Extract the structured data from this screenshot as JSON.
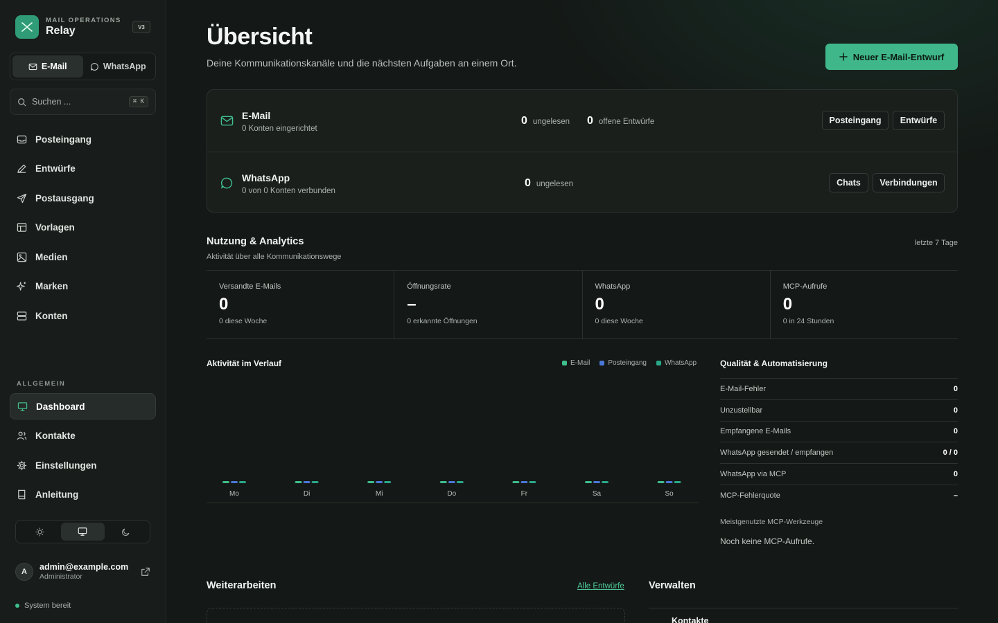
{
  "colors": {
    "accent": "#3fb78a",
    "email_series": "#3fbf8c",
    "inbox_series": "#4a78d6",
    "whatsapp_series": "#2aa98a"
  },
  "brand": {
    "kicker": "MAIL OPERATIONS",
    "name": "Relay",
    "version": "V3",
    "icon": "mail-operations-logo-icon"
  },
  "channel_switch": {
    "email": "E-Mail",
    "whatsapp": "WhatsApp"
  },
  "search": {
    "placeholder": "Suchen ...",
    "shortcut": "⌘ K"
  },
  "nav": {
    "primary": [
      {
        "label": "Posteingang",
        "icon": "inbox-icon"
      },
      {
        "label": "Entwürfe",
        "icon": "pencil-icon"
      },
      {
        "label": "Postausgang",
        "icon": "send-icon"
      },
      {
        "label": "Vorlagen",
        "icon": "template-icon"
      },
      {
        "label": "Medien",
        "icon": "image-icon"
      },
      {
        "label": "Marken",
        "icon": "sparkles-icon"
      },
      {
        "label": "Konten",
        "icon": "server-icon"
      }
    ],
    "section_label": "ALLGEMEIN",
    "general": [
      {
        "label": "Dashboard",
        "icon": "monitor-icon"
      },
      {
        "label": "Kontakte",
        "icon": "users-icon"
      },
      {
        "label": "Einstellungen",
        "icon": "gear-icon"
      },
      {
        "label": "Anleitung",
        "icon": "book-icon"
      }
    ]
  },
  "theme": {
    "options": [
      "light",
      "system",
      "dark"
    ],
    "selected": "system"
  },
  "user": {
    "initial": "A",
    "email": "admin@example.com",
    "role": "Administrator"
  },
  "status": "System bereit",
  "page": {
    "title": "Übersicht",
    "subtitle": "Deine Kommunikationskanäle und die nächsten Aufgaben an einem Ort.",
    "primary_action": "Neuer E-Mail-Entwurf"
  },
  "channels": {
    "email": {
      "name": "E-Mail",
      "sub": "0 Konten eingerichtet",
      "unread_value": "0",
      "unread_label": "ungelesen",
      "drafts_value": "0",
      "drafts_label": "offene Entwürfe",
      "btn1": "Posteingang",
      "btn2": "Entwürfe"
    },
    "whatsapp": {
      "name": "WhatsApp",
      "sub": "0 von 0 Konten verbunden",
      "unread_value": "0",
      "unread_label": "ungelesen",
      "btn1": "Chats",
      "btn2": "Verbindungen"
    }
  },
  "analytics": {
    "title": "Nutzung & Analytics",
    "subtitle": "Aktivität über alle Kommunikationswege",
    "range": "letzte 7 Tage",
    "kpis": [
      {
        "label": "Versandte E-Mails",
        "value": "0",
        "sub": "0 diese Woche"
      },
      {
        "label": "Öffnungsrate",
        "value": "–",
        "sub": "0 erkannte Öffnungen"
      },
      {
        "label": "WhatsApp",
        "value": "0",
        "sub": "0 diese Woche"
      },
      {
        "label": "MCP-Aufrufe",
        "value": "0",
        "sub": "0 in 24 Stunden"
      }
    ]
  },
  "chart_title": "Aktivität im Verlauf",
  "chart_data": {
    "type": "bar",
    "categories": [
      "Mo",
      "Di",
      "Mi",
      "Do",
      "Fr",
      "Sa",
      "So"
    ],
    "series": [
      {
        "name": "E-Mail",
        "values": [
          0,
          0,
          0,
          0,
          0,
          0,
          0
        ]
      },
      {
        "name": "Posteingang",
        "values": [
          0,
          0,
          0,
          0,
          0,
          0,
          0
        ]
      },
      {
        "name": "WhatsApp",
        "values": [
          0,
          0,
          0,
          0,
          0,
          0,
          0
        ]
      }
    ],
    "title": "Aktivität im Verlauf",
    "legend": "top-right",
    "grid": false
  },
  "quality": {
    "title": "Qualität & Automatisierung",
    "rows": [
      {
        "label": "E-Mail-Fehler",
        "value": "0"
      },
      {
        "label": "Unzustellbar",
        "value": "0"
      },
      {
        "label": "Empfangene E-Mails",
        "value": "0"
      },
      {
        "label": "WhatsApp gesendet / empfangen",
        "value": "0 / 0"
      },
      {
        "label": "WhatsApp via MCP",
        "value": "0"
      },
      {
        "label": "MCP-Fehlerquote",
        "value": "–"
      }
    ],
    "tools_title": "Meistgenutzte MCP-Werkzeuge",
    "tools_empty": "Noch keine MCP-Aufrufe."
  },
  "continue": {
    "title": "Weiterarbeiten",
    "link": "Alle Entwürfe"
  },
  "manage": {
    "title": "Verwalten",
    "first_item": "Kontakte"
  }
}
